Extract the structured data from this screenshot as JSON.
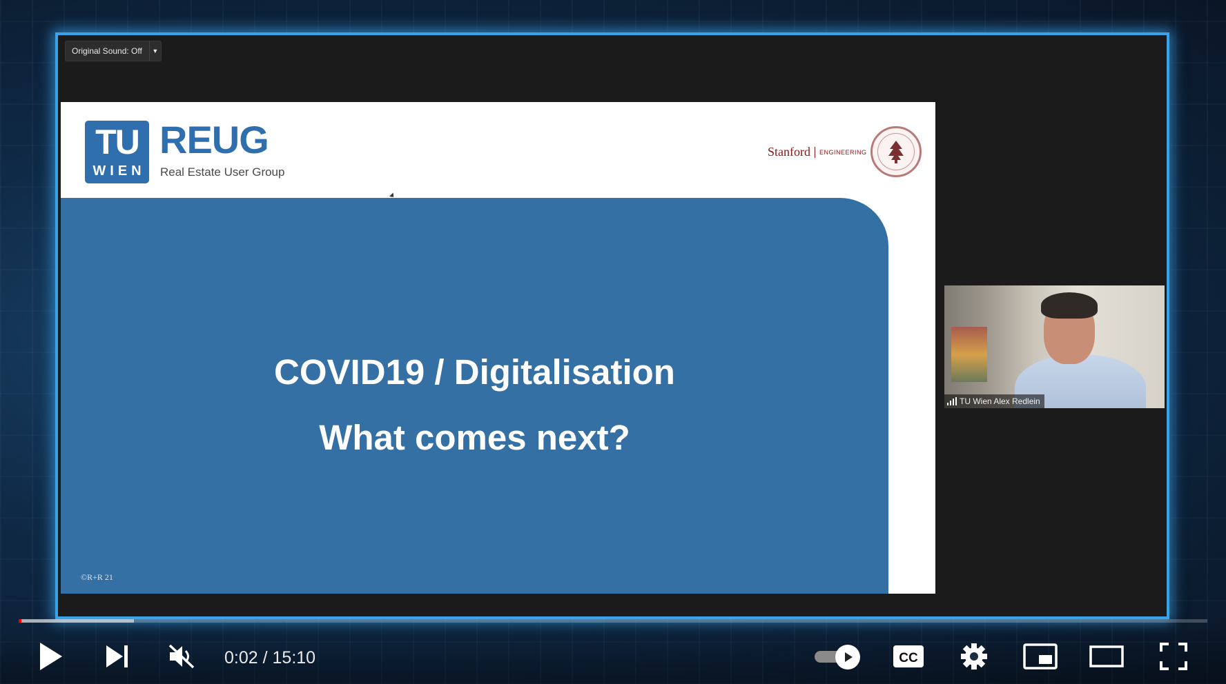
{
  "meeting": {
    "original_sound_label": "Original Sound: Off",
    "dropdown_icon": "caret-down-icon"
  },
  "slide": {
    "tu_logo_top": "TU",
    "tu_logo_bottom": "WIEN",
    "reug_title": "REUG",
    "reug_subtitle": "Real Estate User Group",
    "stanford_name": "Stanford",
    "stanford_dept": "ENGINEERING",
    "title_line1": "COVID19 / Digitalisation",
    "title_line2": "What comes next?",
    "copyright": "©R+R 21",
    "colors": {
      "blue": "#3470a3",
      "logo": "#2f6fad",
      "stanford": "#8c1515"
    }
  },
  "participant": {
    "name": "TU Wien Alex Redlein",
    "signal_icon": "signal-bars-icon"
  },
  "player": {
    "current_time": "0:02",
    "duration": "15:10",
    "time_separator": " / ",
    "progress_played": 0.0022,
    "progress_buffered": 0.097,
    "accent": "#ff0000",
    "controls": {
      "play": "play-icon",
      "next": "next-icon",
      "mute": "muted-volume-icon",
      "autoplay": "autoplay-toggle-icon",
      "captions": "cc-icon",
      "captions_label": "CC",
      "settings": "gear-icon",
      "miniplayer": "miniplayer-icon",
      "theater": "theater-mode-icon",
      "fullscreen": "fullscreen-icon"
    }
  }
}
